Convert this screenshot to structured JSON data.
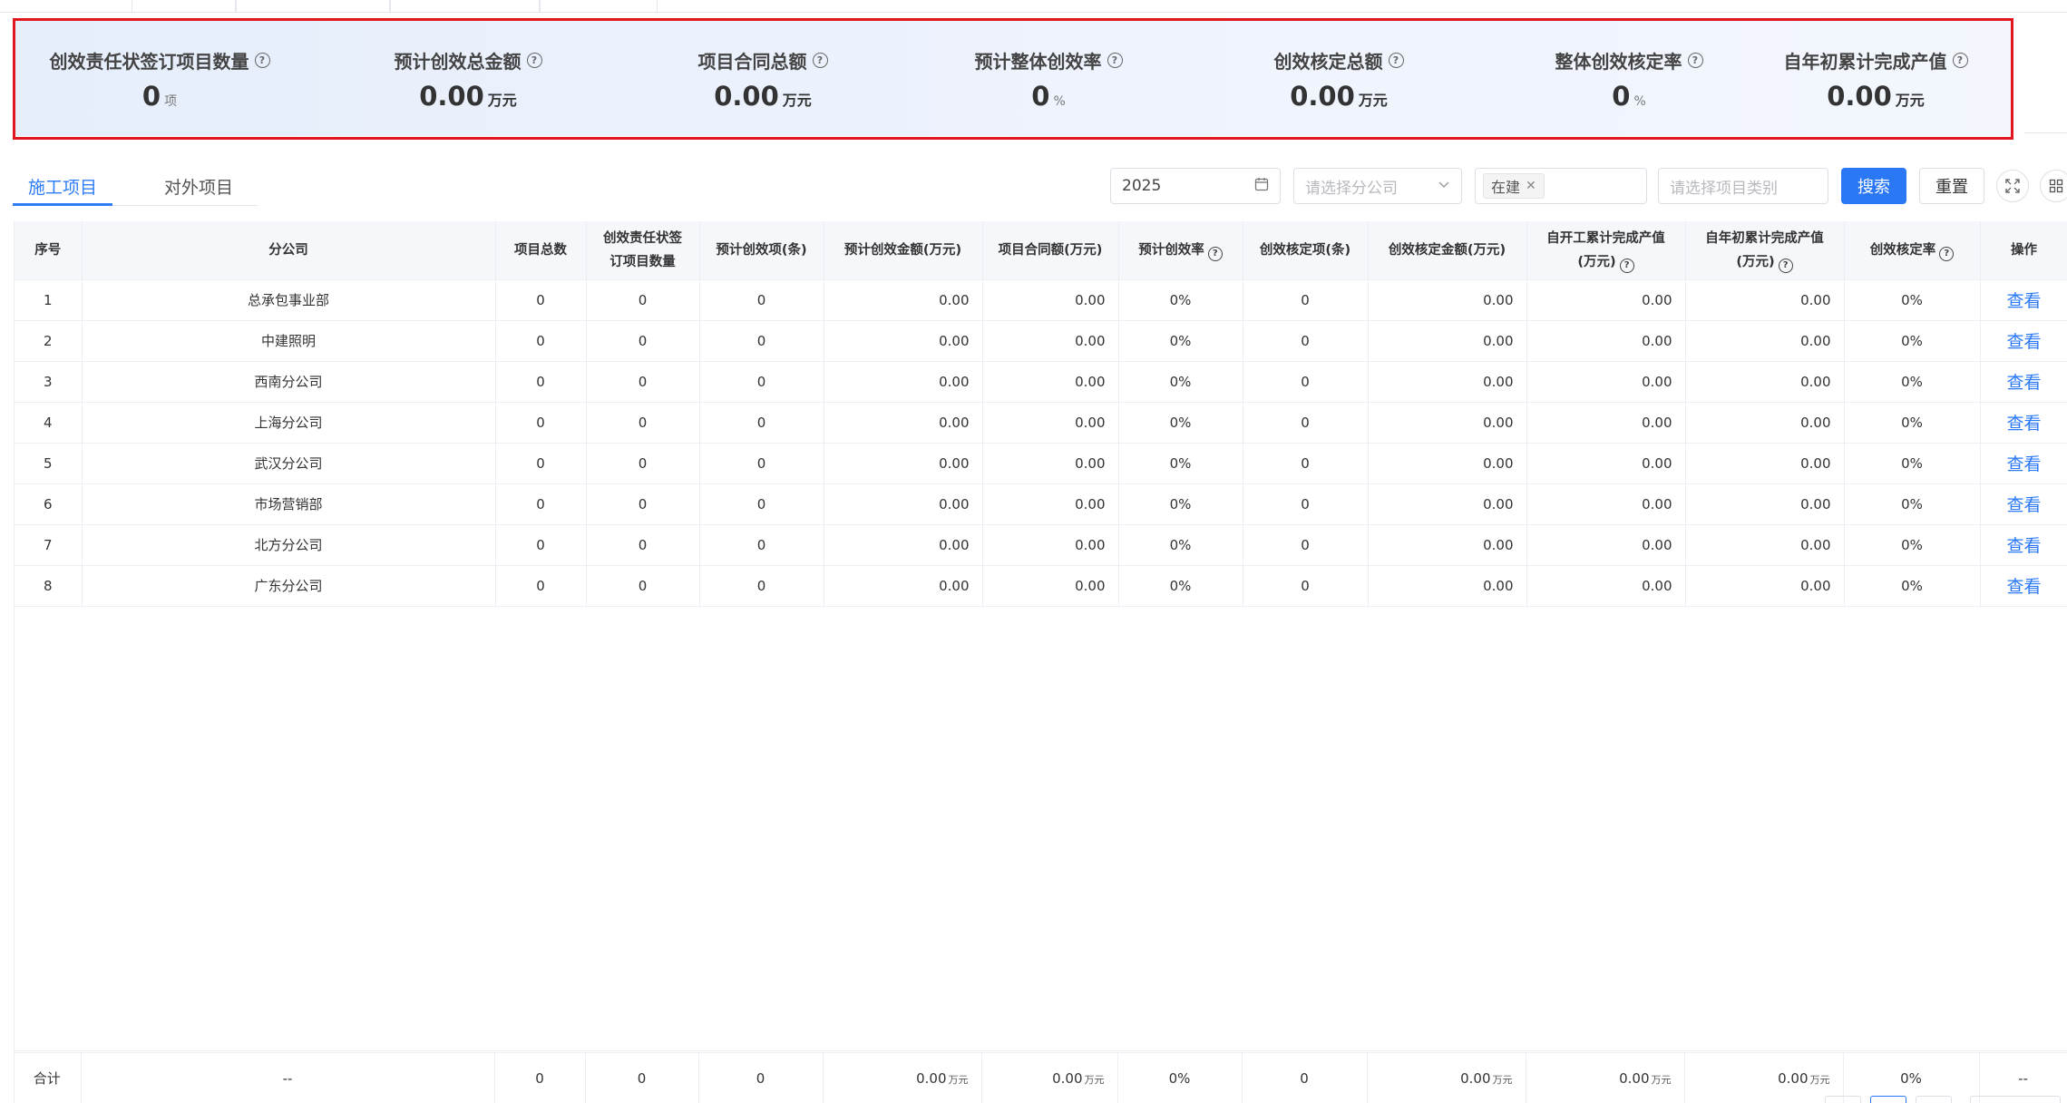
{
  "summary": {
    "stats": [
      {
        "label": "创效责任状签订项目数量",
        "value": "0",
        "unit": "项"
      },
      {
        "label": "预计创效总金额",
        "value": "0.00",
        "unit": "万元"
      },
      {
        "label": "项目合同总额",
        "value": "0.00",
        "unit": "万元"
      },
      {
        "label": "预计整体创效率",
        "value": "0",
        "unit": "%"
      },
      {
        "label": "创效核定总额",
        "value": "0.00",
        "unit": "万元"
      },
      {
        "label": "整体创效核定率",
        "value": "0",
        "unit": "%"
      },
      {
        "label": "自年初累计完成产值",
        "value": "0.00",
        "unit": "万元"
      }
    ],
    "help_glyph": "?"
  },
  "tabs": [
    {
      "label": "施工项目",
      "active": true
    },
    {
      "label": "对外项目",
      "active": false
    }
  ],
  "filters": {
    "year": "2025",
    "branch_placeholder": "请选择分公司",
    "status_tag": "在建",
    "category_placeholder": "请选择项目类别",
    "search_label": "搜索",
    "reset_label": "重置"
  },
  "table": {
    "headers": [
      "序号",
      "分公司",
      "项目总数",
      "创效责任状签订项目数量",
      "预计创效项(条)",
      "预计创效金额(万元)",
      "项目合同额(万元)",
      "预计创效率",
      "创效核定项(条)",
      "创效核定金额(万元)",
      "自开工累计完成产值(万元)",
      "自年初累计完成产值(万元)",
      "创效核定率",
      "操作"
    ],
    "rows": [
      {
        "no": "1",
        "branch": "总承包事业部",
        "total": "0",
        "signed": "0",
        "est_items": "0",
        "est_amount": "0.00",
        "contract": "0.00",
        "est_rate": "0%",
        "ver_items": "0",
        "ver_amount": "0.00",
        "since_start": "0.00",
        "ytd": "0.00",
        "ver_rate": "0%",
        "action": "查看"
      },
      {
        "no": "2",
        "branch": "中建照明",
        "total": "0",
        "signed": "0",
        "est_items": "0",
        "est_amount": "0.00",
        "contract": "0.00",
        "est_rate": "0%",
        "ver_items": "0",
        "ver_amount": "0.00",
        "since_start": "0.00",
        "ytd": "0.00",
        "ver_rate": "0%",
        "action": "查看"
      },
      {
        "no": "3",
        "branch": "西南分公司",
        "total": "0",
        "signed": "0",
        "est_items": "0",
        "est_amount": "0.00",
        "contract": "0.00",
        "est_rate": "0%",
        "ver_items": "0",
        "ver_amount": "0.00",
        "since_start": "0.00",
        "ytd": "0.00",
        "ver_rate": "0%",
        "action": "查看"
      },
      {
        "no": "4",
        "branch": "上海分公司",
        "total": "0",
        "signed": "0",
        "est_items": "0",
        "est_amount": "0.00",
        "contract": "0.00",
        "est_rate": "0%",
        "ver_items": "0",
        "ver_amount": "0.00",
        "since_start": "0.00",
        "ytd": "0.00",
        "ver_rate": "0%",
        "action": "查看"
      },
      {
        "no": "5",
        "branch": "武汉分公司",
        "total": "0",
        "signed": "0",
        "est_items": "0",
        "est_amount": "0.00",
        "contract": "0.00",
        "est_rate": "0%",
        "ver_items": "0",
        "ver_amount": "0.00",
        "since_start": "0.00",
        "ytd": "0.00",
        "ver_rate": "0%",
        "action": "查看"
      },
      {
        "no": "6",
        "branch": "市场营销部",
        "total": "0",
        "signed": "0",
        "est_items": "0",
        "est_amount": "0.00",
        "contract": "0.00",
        "est_rate": "0%",
        "ver_items": "0",
        "ver_amount": "0.00",
        "since_start": "0.00",
        "ytd": "0.00",
        "ver_rate": "0%",
        "action": "查看"
      },
      {
        "no": "7",
        "branch": "北方分公司",
        "total": "0",
        "signed": "0",
        "est_items": "0",
        "est_amount": "0.00",
        "contract": "0.00",
        "est_rate": "0%",
        "ver_items": "0",
        "ver_amount": "0.00",
        "since_start": "0.00",
        "ytd": "0.00",
        "ver_rate": "0%",
        "action": "查看"
      },
      {
        "no": "8",
        "branch": "广东分公司",
        "total": "0",
        "signed": "0",
        "est_items": "0",
        "est_amount": "0.00",
        "contract": "0.00",
        "est_rate": "0%",
        "ver_items": "0",
        "ver_amount": "0.00",
        "since_start": "0.00",
        "ytd": "0.00",
        "ver_rate": "0%",
        "action": "查看"
      }
    ],
    "totals": {
      "label": "合计",
      "branch": "--",
      "total": "0",
      "signed": "0",
      "est_items": "0",
      "est_amount": "0.00",
      "contract": "0.00",
      "est_rate": "0%",
      "ver_items": "0",
      "ver_amount": "0.00",
      "since_start": "0.00",
      "ytd": "0.00",
      "ver_rate": "0%",
      "action": "--",
      "unit": "万元"
    }
  }
}
